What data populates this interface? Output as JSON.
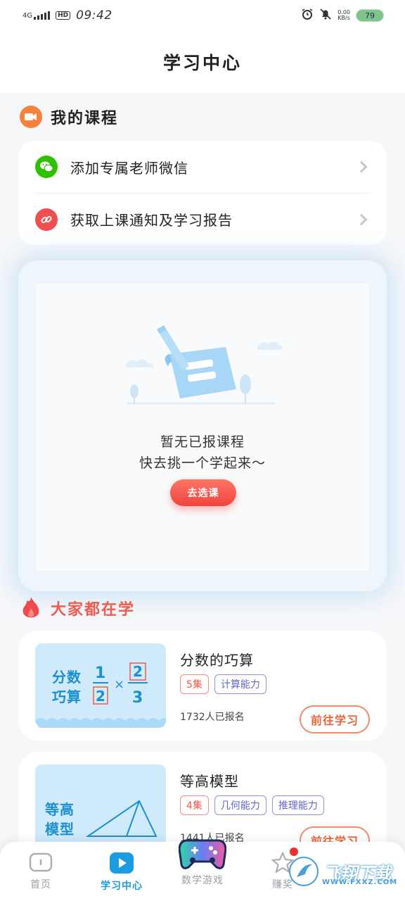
{
  "status_bar": {
    "network": "4G",
    "hd": "HD",
    "time": "09:42",
    "speed_top": "0.00",
    "speed_unit": "KB/s",
    "battery": "79"
  },
  "header": {
    "title": "学习中心"
  },
  "my_courses": {
    "title": "我的课程",
    "icon": "video-icon",
    "rows": [
      {
        "label": "添加专属老师微信",
        "icon": "wechat-icon",
        "color": "#2dc100"
      },
      {
        "label": "获取上课通知及学习报告",
        "icon": "link-icon",
        "color": "#f04f4f"
      }
    ]
  },
  "empty_state": {
    "line1": "暂无已报课程",
    "line2": "快去挑一个学起来～",
    "button": "去选课"
  },
  "popular": {
    "title": "大家都在学",
    "icon": "fire-icon",
    "courses": [
      {
        "thumb_title": "分数\n巧算",
        "name": "分数的巧算",
        "tags": [
          {
            "text": "5集",
            "style": "red"
          },
          {
            "text": "计算能力",
            "style": "blue"
          }
        ],
        "enroll": "1732人已报名",
        "button": "前往学习"
      },
      {
        "thumb_title": "等高\n模型",
        "name": "等高模型",
        "tags": [
          {
            "text": "4集",
            "style": "red"
          },
          {
            "text": "几何能力",
            "style": "blue"
          },
          {
            "text": "推理能力",
            "style": "blue"
          }
        ],
        "enroll": "1441人已报名",
        "button": "前往学习"
      }
    ]
  },
  "bottom_nav": {
    "items": [
      {
        "label": "首页",
        "icon": "book-icon"
      },
      {
        "label": "学习中心",
        "icon": "play-icon",
        "active": true
      },
      {
        "label": "数学游戏",
        "icon": "gamepad-icon"
      },
      {
        "label": "赚奖",
        "icon": "star-icon"
      }
    ]
  },
  "watermark": {
    "text": "飞翔下载",
    "url": "WWW.FXXZ.COM"
  },
  "colors": {
    "accent": "#1a9de0",
    "red": "#f04f4f",
    "orange": "#e9643c"
  }
}
